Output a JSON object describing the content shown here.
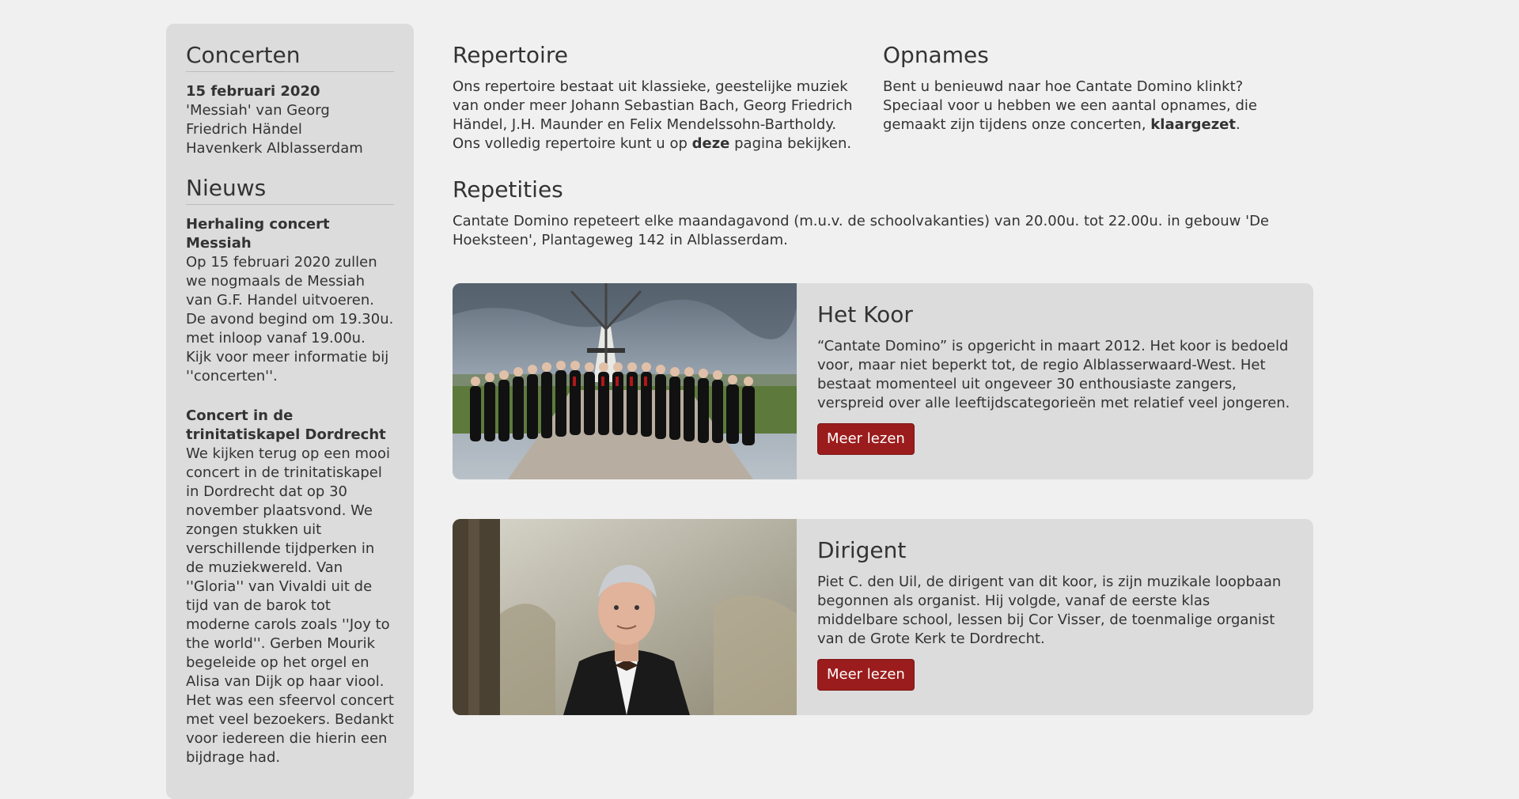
{
  "sidebar": {
    "concerten": {
      "title": "Concerten",
      "date": "15 februari 2020",
      "lines": [
        "'Messiah' van Georg Friedrich Händel",
        "Havenkerk Alblasserdam"
      ]
    },
    "nieuws": {
      "title": "Nieuws",
      "items": [
        {
          "title": "Herhaling concert Messiah",
          "body": "Op 15 februari 2020 zullen we nogmaals de Messiah van G.F. Handel uitvoeren. De avond begind om 19.30u. met inloop vanaf 19.00u. Kijk voor meer informatie bij ''concerten''."
        },
        {
          "title": "Concert in de trinitatiskapel Dordrecht",
          "body": "We kijken terug op een mooi concert in de trinitatiskapel in Dordrecht dat op 30 november plaatsvond. We zongen stukken uit verschillende tijdperken in de muziekwereld. Van ''Gloria'' van Vivaldi uit de tijd van de barok tot moderne carols zoals ''Joy to the world''. Gerben Mourik begeleide op het orgel en Alisa van Dijk op haar viool. Het was een sfeervol concert met veel bezoekers. Bedankt voor iedereen die hierin een bijdrage had."
        }
      ]
    }
  },
  "repertoire": {
    "title": "Repertoire",
    "text_before": "Ons repertoire bestaat uit klassieke, geestelijke muziek van onder meer Johann Sebastian Bach, Georg Friedrich Händel, J.H. Maunder en Felix Mendelssohn-Bartholdy. Ons volledig repertoire kunt u op ",
    "link": "deze",
    "text_after": " pagina bekijken."
  },
  "opnames": {
    "title": "Opnames",
    "text_before": "Bent u benieuwd naar hoe Cantate Domino klinkt? Speciaal voor u hebben we een aantal opnames, die gemaakt zijn tijdens onze concerten, ",
    "link": "klaargezet",
    "text_after": "."
  },
  "repetities": {
    "title": "Repetities",
    "text": "Cantate Domino repeteert elke maandagavond (m.u.v. de schoolvakanties) van 20.00u. tot 22.00u. in gebouw 'De Hoeksteen', Plantageweg 142 in Alblasserdam."
  },
  "cards": {
    "koor": {
      "title": "Het Koor",
      "text": "“Cantate Domino” is opgericht in maart 2012. Het koor is bedoeld voor, maar niet beperkt tot, de regio Alblasserwaard-West. Het bestaat momenteel uit ongeveer 30 enthousiaste zangers, verspreid over alle leeftijdscategorieën met relatief veel jongeren.",
      "button": "Meer lezen"
    },
    "dirigent": {
      "title": "Dirigent",
      "text": "Piet C. den Uil, de dirigent van dit koor, is zijn muzikale loopbaan begonnen als organist. Hij volgde, vanaf de eerste klas middelbare school, lessen bij Cor Visser, de toenmalige organist van de Grote Kerk te Dordrecht.",
      "button": "Meer lezen"
    }
  },
  "colors": {
    "background": "#f0f0f0",
    "panel": "#dcdcdc",
    "button": "#9b1c1c",
    "text": "#333333"
  }
}
